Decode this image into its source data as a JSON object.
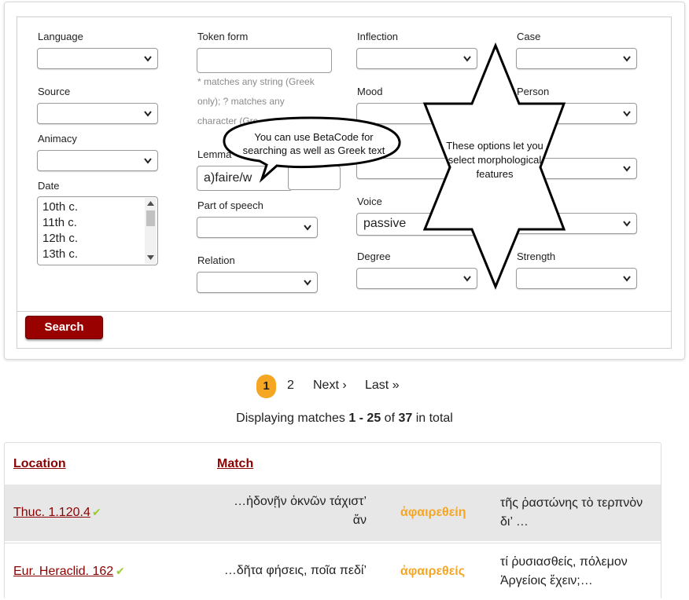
{
  "form": {
    "language_label": "Language",
    "token_form_label": "Token form",
    "inflection_label": "Inflection",
    "case_label": "Case",
    "source_label": "Source",
    "mood_label": "Mood",
    "person_label": "Person",
    "animacy_label": "Animacy",
    "lemma_label": "Lemma",
    "lemma_value": "a)faire/w",
    "date_label": "Date",
    "date_options": [
      "10th c.",
      "11th c.",
      "12th c.",
      "13th c."
    ],
    "pos_label": "Part of speech",
    "voice_label": "Voice",
    "voice_value": "passive",
    "relation_label": "Relation",
    "degree_label": "Degree",
    "strength_label": "Strength",
    "token_hint_1": "* matches any string (Greek",
    "token_hint_2": "only); ? matches any",
    "token_hint_3": "character (Gre",
    "search_label": "Search"
  },
  "annotations": {
    "bubble_text": "You can use BetaCode for searching as well as Greek text",
    "star_text": "These options let you select morphological features"
  },
  "pager": {
    "current": "1",
    "page2": "2",
    "next": "Next ›",
    "last": "Last »"
  },
  "summary": {
    "prefix": "Displaying matches ",
    "range": "1 - 25",
    "of": " of ",
    "total": "37",
    "suffix": " in total"
  },
  "results": {
    "col_location": "Location",
    "col_match": "Match",
    "rows": [
      {
        "location": "Thuc. 1.120.4",
        "pre_1": "…ἡδονῇν ὀκνῶν τάχιστ’",
        "pre_2": "ἄν",
        "hit": "ἀφαιρεθείη",
        "post_1": "τῆς ῥαστώνης τὸ τερπνὸν",
        "post_2": "δι’ …"
      },
      {
        "location": "Eur. Heraclid. 162",
        "pre_1": "…δῆτα φήσεις, ποῖα πεδί’",
        "pre_2": "",
        "hit": "ἀφαιρεθείς",
        "post_1": "τί ῥυσιασθείς, πόλεμον",
        "post_2": "Ἀργείοις ἕχειν;…"
      }
    ]
  },
  "icons": {
    "dropdown": "chevron-down-icon",
    "verified": "checkmark-icon"
  },
  "colors": {
    "accent_red": "#990000",
    "link_red": "#8b0000",
    "highlight_orange": "#f5a623",
    "check_green": "#9acd32",
    "row_gray": "#e7e7e7"
  }
}
